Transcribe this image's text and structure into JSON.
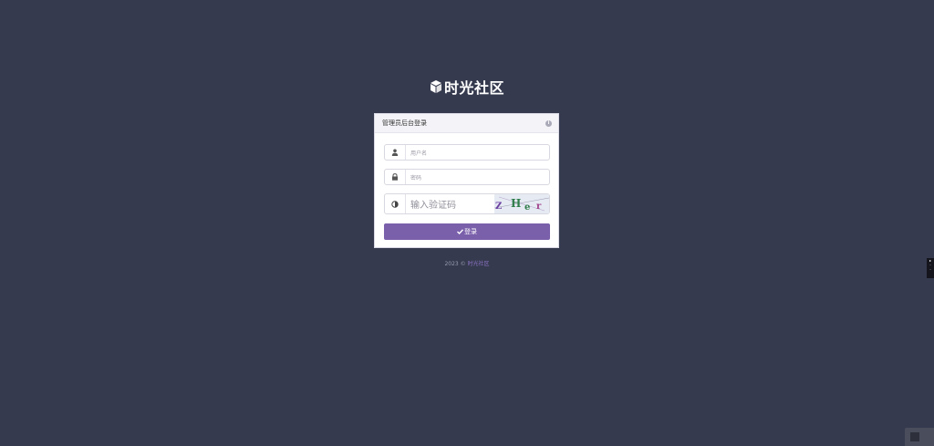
{
  "brand": {
    "title": "时光社区",
    "logo_icon": "cube-icon"
  },
  "login_panel": {
    "title": "管理员后台登录",
    "username": {
      "placeholder": "用户名",
      "icon": "user-icon"
    },
    "password": {
      "placeholder": "密码",
      "icon": "lock-icon"
    },
    "captcha": {
      "placeholder": "输入验证码",
      "icon": "contrast-icon",
      "image_text": "Z H e r"
    },
    "submit_label": "登录"
  },
  "footer": {
    "prefix": "2023 ©",
    "link_text": "时光社区"
  },
  "colors": {
    "background": "#363a4e",
    "accent": "#7a5fab"
  }
}
